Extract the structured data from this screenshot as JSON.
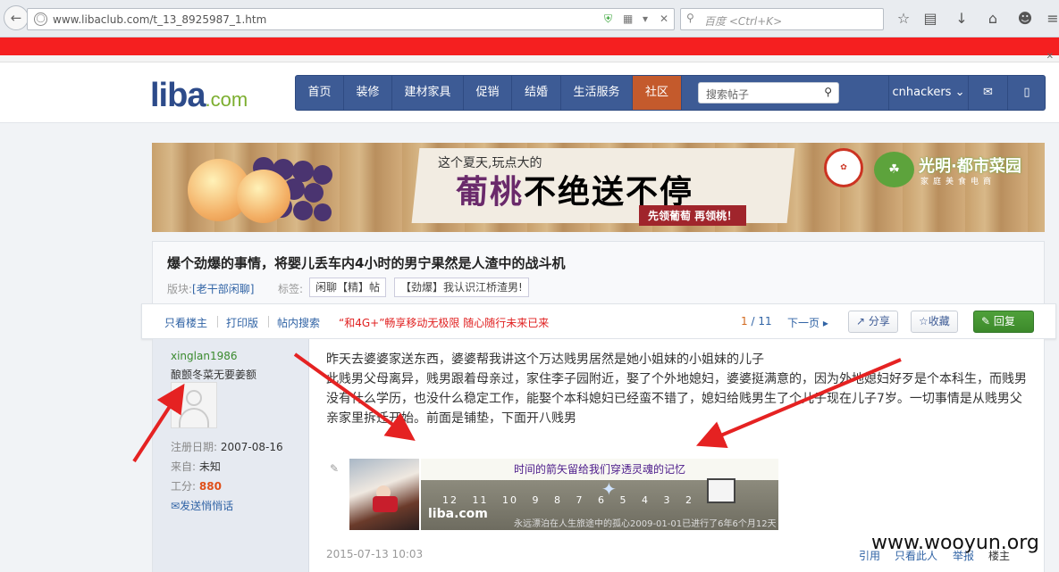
{
  "browser": {
    "url": "www.libaclub.com/t_13_8925987_1.htm",
    "search_placeholder": "百度 <Ctrl+K>"
  },
  "site": {
    "logo_main": "liba",
    "logo_domain": ".com",
    "nav": [
      "首页",
      "装修",
      "建材家具",
      "促销",
      "结婚",
      "生活服务",
      "社区"
    ],
    "search_placeholder": "搜索帖子",
    "user": "cnhackers"
  },
  "banner": {
    "line1": "这个夏天,玩点大的",
    "line2a": "葡桃",
    "line2b": "不绝送不停",
    "line3": "先领葡萄 再领桃！",
    "brand": "光明·都市菜园",
    "brand_sub": "家庭美食电商"
  },
  "post": {
    "title": "爆个劲爆的事情，将婴儿丢车内4小时的男宁果然是人渣中的战斗机",
    "board_label": "版块:",
    "board": "[老干部闲聊]",
    "tags_label": "标签:",
    "tags": [
      "闲聊【精】帖",
      "【劲爆】我认识江桥渣男!"
    ]
  },
  "toolbar": {
    "only_author": "只看楼主",
    "print": "打印版",
    "search_in": "帖内搜索",
    "promo": "“和4G+”畅享移动无极限 随心随行未来已来",
    "page_current": "1",
    "page_sep": "/",
    "page_total": "11",
    "next": "下一页",
    "share": "分享",
    "fav": "收藏",
    "reply": "回复"
  },
  "author": {
    "name": "xinglan1986",
    "signature": "酿颤冬菜无要姜额",
    "reg_label": "注册日期:",
    "reg_date": "2007-08-16",
    "from_label": "来自:",
    "from": "未知",
    "score_label": "工分:",
    "score": "880",
    "message": "发送悄悄话"
  },
  "content": {
    "p1": "昨天去婆婆家送东西，婆婆帮我讲这个万达贱男居然是她小姐妹的小姐妹的儿子",
    "p2": "此贱男父母离异，贱男跟着母亲过，家住李子园附近，娶了个外地媳妇，婆婆挺满意的，因为外地媳妇好歹是个本科生，而贱男没有什么学历，也没什么稳定工作，能娶个本科媳妇已经蛮不错了，媳妇给贱男生了个儿子现在儿子7岁。一切事情是从贱男父亲家里拆迁开始。前面是铺垫，下面开八贱男",
    "sig_title": "时间的箭矢留给我们穿透灵魂的记忆",
    "sig_numbers": "12 11 10 9 8 7 6 5 4 3 2 1",
    "sig_logo": "liba.com",
    "sig_footer": "永远漂泊在人生旅途中的孤心2009-01-01已进行了6年6个月12天",
    "date": "2015-07-13 10:03",
    "quote": "引用",
    "only_this": "只看此人",
    "report": "举报",
    "floor": "楼主"
  },
  "watermark": "www.wooyun.org"
}
